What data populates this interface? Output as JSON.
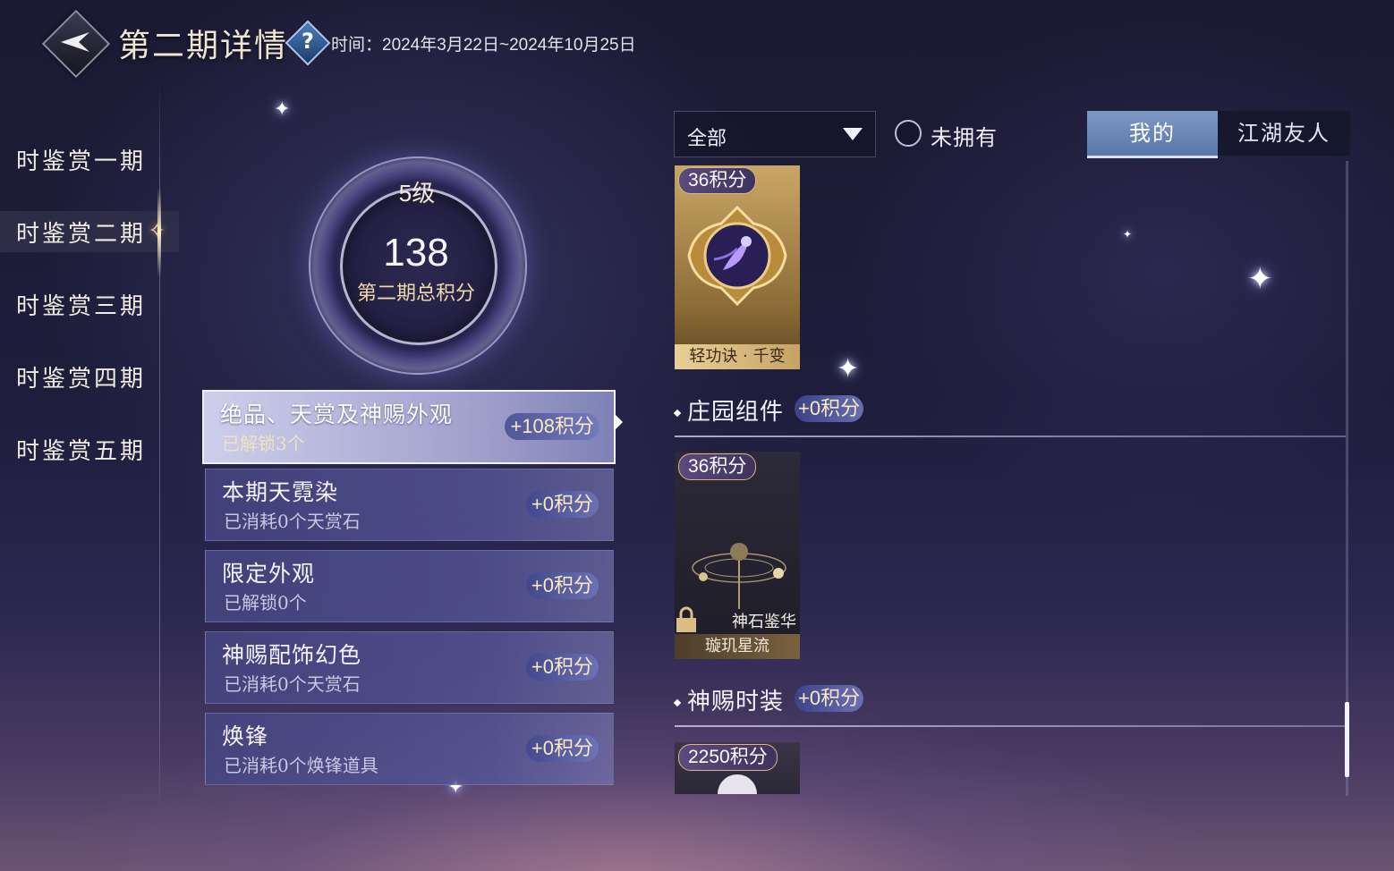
{
  "header": {
    "title": "第二期详情",
    "help_icon": "?",
    "time_label": "时间：2024年3月22日~2024年10月25日"
  },
  "nav": {
    "items": [
      {
        "label": "时鉴赏一期"
      },
      {
        "label": "时鉴赏二期",
        "active": true
      },
      {
        "label": "时鉴赏三期"
      },
      {
        "label": "时鉴赏四期"
      },
      {
        "label": "时鉴赏五期"
      }
    ],
    "active_marker": "✧"
  },
  "score": {
    "level": "5级",
    "total": "138",
    "caption": "第二期总积分"
  },
  "categories": [
    {
      "title": "绝品、天赏及神赐外观",
      "sub": "已解锁3个",
      "points": "+108积分",
      "active": true
    },
    {
      "title": "本期天霓染",
      "sub": "已消耗0个天赏石",
      "points": "+0积分"
    },
    {
      "title": "限定外观",
      "sub": "已解锁0个",
      "points": "+0积分"
    },
    {
      "title": "神赐配饰幻色",
      "sub": "已消耗0个天赏石",
      "points": "+0积分"
    },
    {
      "title": "焕锋",
      "sub": "已消耗0个焕锋道具",
      "points": "+0积分"
    }
  ],
  "filter": {
    "select_value": "全部",
    "checkbox_label": "未拥有"
  },
  "tabs": {
    "mine": "我的",
    "friends": "江湖友人"
  },
  "items": {
    "card1": {
      "points": "36积分",
      "label": "轻功诀 · 千变"
    },
    "section1": {
      "title": "庄园组件",
      "points": "+0积分"
    },
    "card2": {
      "points": "36积分",
      "name": "神石鉴华",
      "label": "璇玑星流"
    },
    "section2": {
      "title": "神赐时装",
      "points": "+0积分"
    },
    "card3": {
      "points": "2250积分"
    }
  },
  "colors": {
    "accent_gold": "#f0d9a8",
    "tab_active": "#6f8ab9",
    "points_text": "#ffe8c0"
  },
  "icons": [
    "back-arrow-icon",
    "help-icon",
    "chevron-down-icon",
    "lock-icon",
    "sparkle-icon"
  ]
}
